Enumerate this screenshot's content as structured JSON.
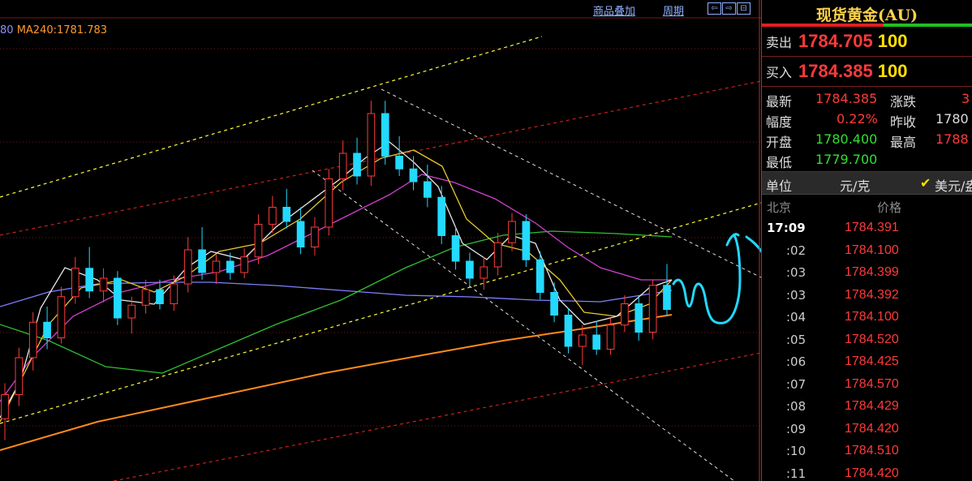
{
  "toolbar": {
    "overlay_label": "商品叠加",
    "period_label": "周期"
  },
  "ma_legend": {
    "prefix": "80",
    "ma240_text": "MA240:1781.783"
  },
  "panel": {
    "title": "现货黄金(AU)",
    "sell_label": "卖出",
    "sell_price": "1784.705",
    "sell_volume": "100",
    "buy_label": "买入",
    "buy_price": "1784.385",
    "buy_volume": "100",
    "latest_label": "最新",
    "latest_value": "1784.385",
    "change_label": "涨跌",
    "change_value": "3",
    "amplitude_label": "幅度",
    "amplitude_value": "0.22%",
    "prev_close_label": "昨收",
    "prev_close_value": "1780",
    "open_label": "开盘",
    "open_value": "1780.400",
    "high_label": "最高",
    "high_value": "1788",
    "low_label": "最低",
    "low_value": "1779.700",
    "unit_label": "单位",
    "unit_value": "元/克",
    "unit_alt": "美元/盎",
    "tick_location": "北京",
    "tick_price_header": "价格",
    "ticks": [
      {
        "time": "17:09",
        "price": "1784.391"
      },
      {
        "time": ":02",
        "price": "1784.100"
      },
      {
        "time": ":03",
        "price": "1784.399"
      },
      {
        "time": ":03",
        "price": "1784.392"
      },
      {
        "time": ":04",
        "price": "1784.100"
      },
      {
        "time": ":05",
        "price": "1784.520"
      },
      {
        "time": ":06",
        "price": "1784.425"
      },
      {
        "time": ":07",
        "price": "1784.570"
      },
      {
        "time": ":08",
        "price": "1784.429"
      },
      {
        "time": ":09",
        "price": "1784.420"
      },
      {
        "time": ":10",
        "price": "1784.510"
      },
      {
        "time": ":11",
        "price": "1784.420"
      }
    ]
  },
  "colors": {
    "up": "#ff3a3a",
    "down": "#23d9ff",
    "ma_white": "#e8e8e8",
    "ma_yellow": "#e8c830",
    "ma_magenta": "#d040d0",
    "ma_green": "#30c030",
    "ma_blue": "#8080ff",
    "ma_orange": "#ff8a1a",
    "channel_yellow": "#ffff30",
    "channel_red": "#e02020",
    "channel_white": "#dddddd",
    "grid": "#7a1818"
  },
  "chart_data": {
    "type": "candlestick",
    "title": "",
    "ylim": [
      1765,
      1795
    ],
    "candles": [
      {
        "o": 1767.5,
        "h": 1770.0,
        "l": 1766.0,
        "c": 1769.2
      },
      {
        "o": 1769.2,
        "h": 1772.5,
        "l": 1768.4,
        "c": 1771.8
      },
      {
        "o": 1771.8,
        "h": 1775.0,
        "l": 1770.9,
        "c": 1774.3
      },
      {
        "o": 1774.3,
        "h": 1775.4,
        "l": 1772.4,
        "c": 1773.2
      },
      {
        "o": 1773.2,
        "h": 1776.8,
        "l": 1772.8,
        "c": 1776.1
      },
      {
        "o": 1776.1,
        "h": 1778.9,
        "l": 1775.6,
        "c": 1778.1
      },
      {
        "o": 1778.1,
        "h": 1779.6,
        "l": 1776.0,
        "c": 1776.5
      },
      {
        "o": 1776.5,
        "h": 1778.1,
        "l": 1775.7,
        "c": 1777.4
      },
      {
        "o": 1777.4,
        "h": 1777.9,
        "l": 1774.1,
        "c": 1774.6
      },
      {
        "o": 1774.6,
        "h": 1776.1,
        "l": 1773.5,
        "c": 1775.5
      },
      {
        "o": 1775.5,
        "h": 1777.3,
        "l": 1774.9,
        "c": 1776.6
      },
      {
        "o": 1776.6,
        "h": 1777.3,
        "l": 1775.2,
        "c": 1775.6
      },
      {
        "o": 1775.6,
        "h": 1777.6,
        "l": 1775.1,
        "c": 1777.0
      },
      {
        "o": 1777.0,
        "h": 1780.3,
        "l": 1776.4,
        "c": 1779.4
      },
      {
        "o": 1779.4,
        "h": 1781.0,
        "l": 1777.3,
        "c": 1777.8
      },
      {
        "o": 1777.8,
        "h": 1779.1,
        "l": 1777.0,
        "c": 1778.6
      },
      {
        "o": 1778.6,
        "h": 1779.2,
        "l": 1777.3,
        "c": 1777.8
      },
      {
        "o": 1777.8,
        "h": 1779.5,
        "l": 1777.4,
        "c": 1778.9
      },
      {
        "o": 1778.9,
        "h": 1781.9,
        "l": 1778.4,
        "c": 1781.2
      },
      {
        "o": 1781.2,
        "h": 1783.2,
        "l": 1780.6,
        "c": 1782.4
      },
      {
        "o": 1782.4,
        "h": 1783.7,
        "l": 1780.9,
        "c": 1781.4
      },
      {
        "o": 1781.4,
        "h": 1782.4,
        "l": 1779.1,
        "c": 1779.6
      },
      {
        "o": 1779.6,
        "h": 1781.7,
        "l": 1779.0,
        "c": 1781.0
      },
      {
        "o": 1781.0,
        "h": 1785.1,
        "l": 1780.4,
        "c": 1784.4
      },
      {
        "o": 1784.4,
        "h": 1787.1,
        "l": 1783.6,
        "c": 1786.2
      },
      {
        "o": 1786.2,
        "h": 1787.3,
        "l": 1784.0,
        "c": 1784.6
      },
      {
        "o": 1784.6,
        "h": 1789.9,
        "l": 1783.9,
        "c": 1789.0
      },
      {
        "o": 1789.0,
        "h": 1789.9,
        "l": 1785.4,
        "c": 1786.0
      },
      {
        "o": 1786.0,
        "h": 1787.4,
        "l": 1784.6,
        "c": 1785.1
      },
      {
        "o": 1785.1,
        "h": 1786.0,
        "l": 1783.6,
        "c": 1784.2
      },
      {
        "o": 1784.2,
        "h": 1785.4,
        "l": 1782.4,
        "c": 1783.1
      },
      {
        "o": 1783.1,
        "h": 1783.9,
        "l": 1779.8,
        "c": 1780.4
      },
      {
        "o": 1780.4,
        "h": 1781.0,
        "l": 1778.0,
        "c": 1778.6
      },
      {
        "o": 1778.6,
        "h": 1779.2,
        "l": 1776.9,
        "c": 1777.4
      },
      {
        "o": 1777.4,
        "h": 1778.9,
        "l": 1776.6,
        "c": 1778.2
      },
      {
        "o": 1778.2,
        "h": 1780.6,
        "l": 1777.6,
        "c": 1779.9
      },
      {
        "o": 1779.9,
        "h": 1782.0,
        "l": 1779.3,
        "c": 1781.4
      },
      {
        "o": 1781.4,
        "h": 1781.9,
        "l": 1778.2,
        "c": 1778.7
      },
      {
        "o": 1778.7,
        "h": 1779.3,
        "l": 1775.9,
        "c": 1776.4
      },
      {
        "o": 1776.4,
        "h": 1777.1,
        "l": 1774.3,
        "c": 1774.8
      },
      {
        "o": 1774.8,
        "h": 1775.3,
        "l": 1772.1,
        "c": 1772.6
      },
      {
        "o": 1772.6,
        "h": 1774.1,
        "l": 1771.3,
        "c": 1773.4
      },
      {
        "o": 1773.4,
        "h": 1774.4,
        "l": 1772.0,
        "c": 1772.4
      },
      {
        "o": 1772.4,
        "h": 1774.6,
        "l": 1772.0,
        "c": 1774.1
      },
      {
        "o": 1774.1,
        "h": 1776.2,
        "l": 1773.6,
        "c": 1775.6
      },
      {
        "o": 1775.6,
        "h": 1776.1,
        "l": 1773.0,
        "c": 1773.6
      },
      {
        "o": 1773.6,
        "h": 1777.3,
        "l": 1773.1,
        "c": 1776.9
      },
      {
        "o": 1776.9,
        "h": 1778.4,
        "l": 1774.8,
        "c": 1775.2
      }
    ],
    "ma": [
      {
        "name": "MA240",
        "value": 1781.783
      }
    ],
    "annotations": [
      "channel-lines",
      "trend-lines",
      "hand-drawn-projection"
    ]
  }
}
